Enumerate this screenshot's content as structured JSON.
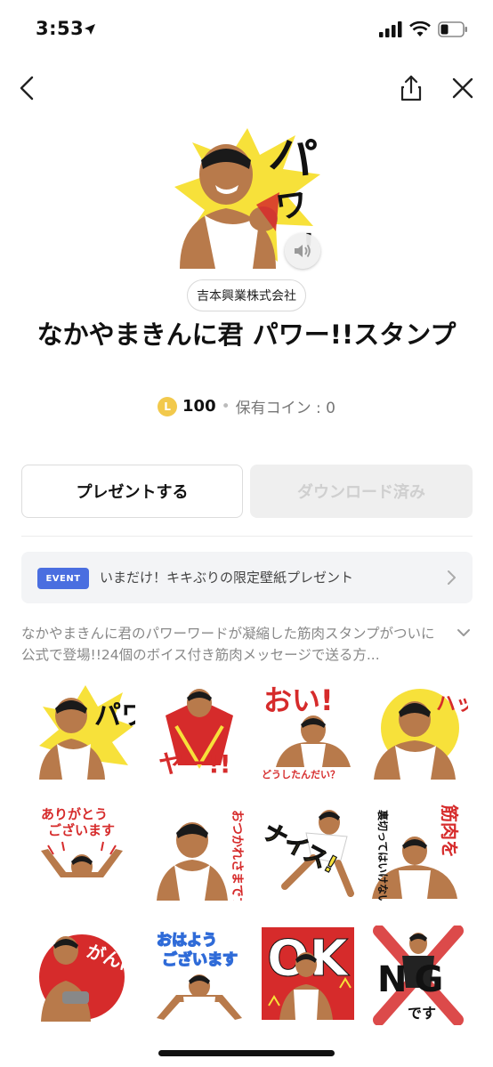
{
  "status": {
    "time": "3:53"
  },
  "publisher": "吉本興業株式会社",
  "title": "なかやまきんに君 パワー!!スタンプ",
  "price": {
    "coin_letter": "L",
    "amount": "100",
    "separator": "•",
    "balance": "保有コイン : 0"
  },
  "buttons": {
    "present": "プレゼントする",
    "download": "ダウンロード済み"
  },
  "event": {
    "badge": "EVENT",
    "text": "いまだけ！キキぶりの限定壁紙プレゼント"
  },
  "description": "なかやまきんに君のパワーワードが凝縮した筋肉スタンプがついに公式で登場!!24個のボイス付き筋肉メッセージで送る方...",
  "stickers": [
    {
      "text": "パワー!!"
    },
    {
      "text": "ヤー!!"
    },
    {
      "text": "おい!",
      "sub": "どうしたんだい？"
    },
    {
      "text": "ハッ"
    },
    {
      "text": "ありがとう",
      "sub": "ございます"
    },
    {
      "text": "おつかれさまです"
    },
    {
      "text": "ナイス!"
    },
    {
      "text": "裏切ってはいけない",
      "sub": "筋肉を"
    },
    {
      "text": "がんばろう"
    },
    {
      "text": "おはよう",
      "sub": "ございます"
    },
    {
      "text": "OK"
    },
    {
      "text": "NG",
      "sub": "です"
    }
  ],
  "colors": {
    "accent": "#4a6ee0",
    "coin": "#f2c94c",
    "red": "#d62b2b",
    "yellow": "#f7e13a"
  }
}
